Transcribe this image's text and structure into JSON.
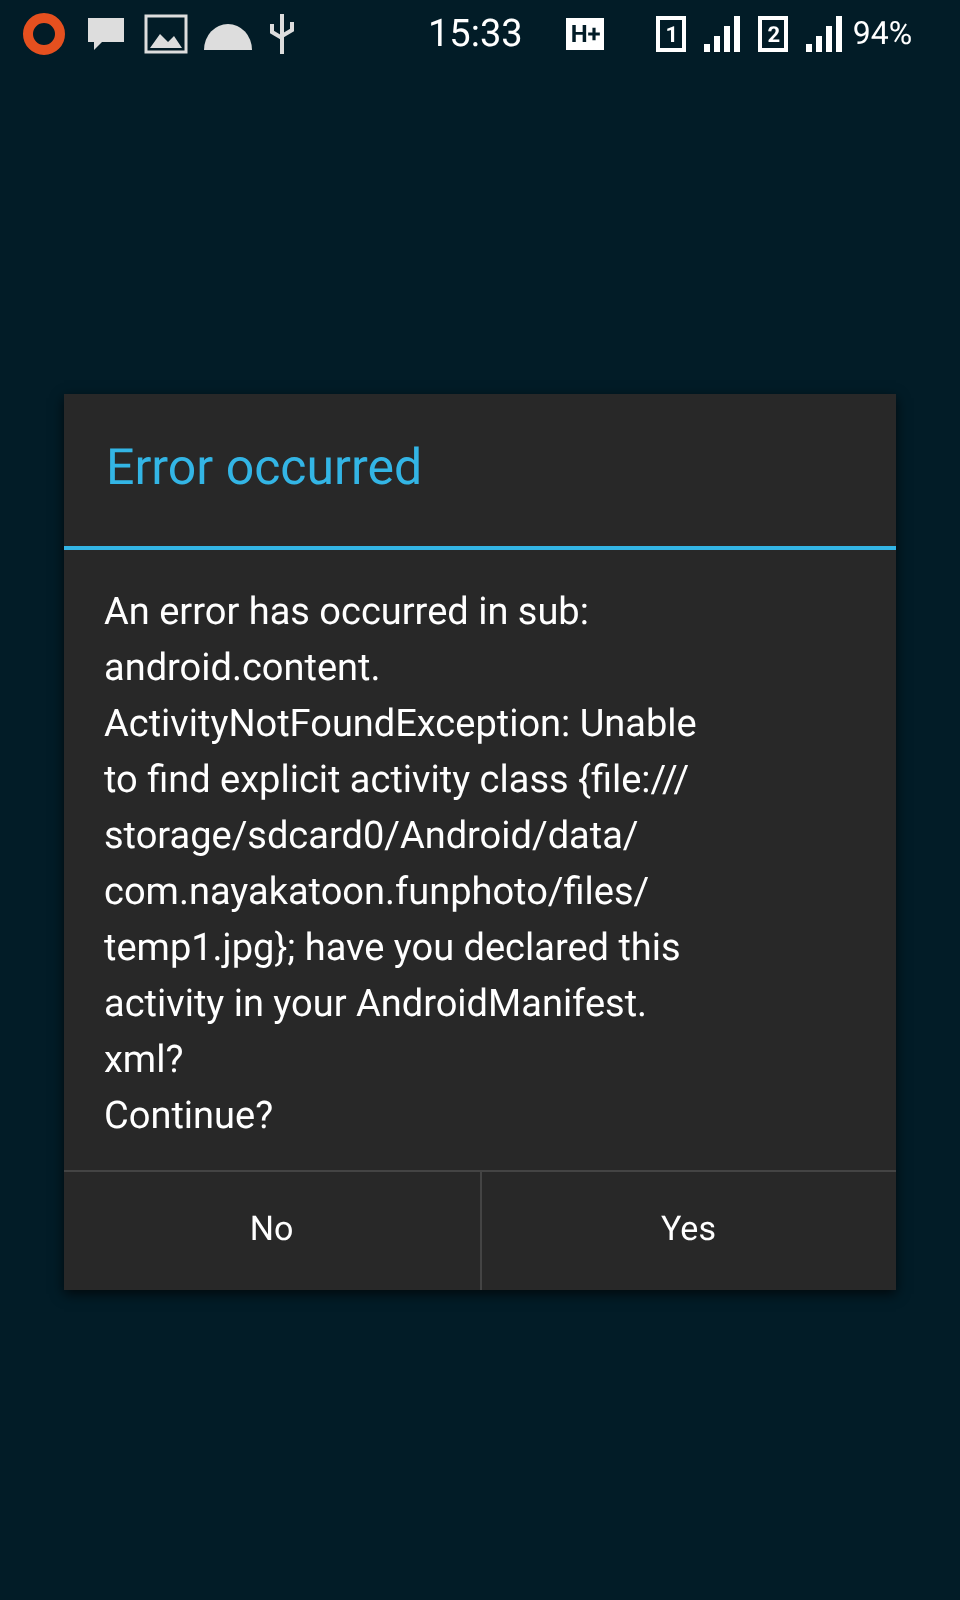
{
  "status_bar": {
    "time": "15:33",
    "network": "H+",
    "sim_1": "1",
    "sim_2": "2",
    "battery": "94%"
  },
  "dialog": {
    "title": "Error occurred",
    "message": "An error has occurred in sub:\nandroid.content.\nActivityNotFoundException: Unable\nto find explicit activity class {file:///\nstorage/sdcard0/Android/data/\ncom.nayakatoon.funphoto/files/\ntemp1.jpg}; have you declared this\nactivity in your AndroidManifest.\nxml?\nContinue?",
    "buttons": [
      "No",
      "Yes"
    ]
  }
}
